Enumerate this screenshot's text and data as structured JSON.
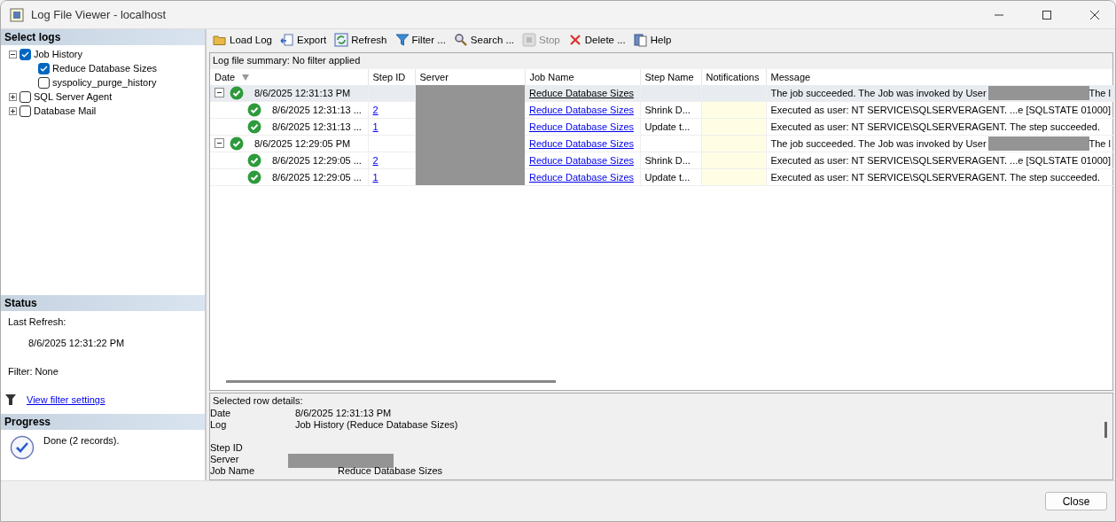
{
  "window": {
    "title": "Log File Viewer - localhost"
  },
  "select_logs": {
    "title": "Select logs",
    "tree": [
      {
        "label": "Job History",
        "checked": true,
        "expanded": true,
        "children": [
          {
            "label": "Reduce Database Sizes",
            "checked": true
          },
          {
            "label": "syspolicy_purge_history",
            "checked": false
          }
        ]
      },
      {
        "label": "SQL Server Agent",
        "checked": false,
        "expanded": false
      },
      {
        "label": "Database Mail",
        "checked": false,
        "expanded": false
      }
    ]
  },
  "status": {
    "title": "Status",
    "last_refresh_label": "Last Refresh:",
    "last_refresh": "8/6/2025 12:31:22 PM",
    "filter": "Filter: None",
    "link": "View filter settings"
  },
  "progress": {
    "title": "Progress",
    "text": "Done (2 records)."
  },
  "toolbar": [
    {
      "kind": "folder",
      "label": "Load Log",
      "disabled": false
    },
    {
      "kind": "export",
      "label": "Export",
      "disabled": false
    },
    {
      "kind": "refresh",
      "label": "Refresh",
      "disabled": false
    },
    {
      "kind": "filter",
      "label": "Filter ...",
      "disabled": false
    },
    {
      "kind": "search",
      "label": "Search ...",
      "disabled": false
    },
    {
      "kind": "stop",
      "label": "Stop",
      "disabled": true
    },
    {
      "kind": "delete",
      "label": "Delete ...",
      "disabled": false
    },
    {
      "kind": "help",
      "label": "Help",
      "disabled": false
    }
  ],
  "summary": "Log file summary: No filter applied",
  "table": {
    "columns": [
      "Date",
      "Step ID",
      "Server",
      "Job Name",
      "Step Name",
      "Notifications",
      "Message"
    ],
    "rows": [
      {
        "kind": "job",
        "expanded": true,
        "selected": true,
        "date": "8/6/2025 12:31:13 PM",
        "step_id": "",
        "job_name": "Reduce Database Sizes",
        "step_name": "",
        "message": "The job succeeded.  The Job was invoked by User",
        "message_tail": "The l"
      },
      {
        "kind": "step",
        "selected": false,
        "date": "8/6/2025 12:31:13 ...",
        "step_id": "2",
        "job_name": "Reduce Database Sizes",
        "step_name": "Shrink D...",
        "message": "Executed as user: NT SERVICE\\SQLSERVERAGENT. ...e [SQLSTATE 01000]"
      },
      {
        "kind": "step",
        "selected": false,
        "date": "8/6/2025 12:31:13 ...",
        "step_id": "1",
        "job_name": "Reduce Database Sizes",
        "step_name": "Update t...",
        "message": "Executed as user: NT SERVICE\\SQLSERVERAGENT. The step succeeded."
      },
      {
        "kind": "job",
        "expanded": true,
        "selected": false,
        "date": "8/6/2025 12:29:05 PM",
        "step_id": "",
        "job_name": "Reduce Database Sizes",
        "step_name": "",
        "message": "The job succeeded.  The Job was invoked by User",
        "message_tail": "The l"
      },
      {
        "kind": "step",
        "selected": false,
        "date": "8/6/2025 12:29:05 ...",
        "step_id": "2",
        "job_name": "Reduce Database Sizes",
        "step_name": "Shrink D...",
        "message": "Executed as user: NT SERVICE\\SQLSERVERAGENT. ...e [SQLSTATE 01000]"
      },
      {
        "kind": "step",
        "selected": false,
        "date": "8/6/2025 12:29:05 ...",
        "step_id": "1",
        "job_name": "Reduce Database Sizes",
        "step_name": "Update t...",
        "message": "Executed as user: NT SERVICE\\SQLSERVERAGENT. The step succeeded."
      }
    ]
  },
  "details": {
    "title": "Selected row details:",
    "fields": [
      {
        "kind": "text",
        "label": "Date",
        "value": "8/6/2025 12:31:13 PM"
      },
      {
        "kind": "text",
        "label": "Log",
        "value": "Job History (Reduce Database Sizes)"
      },
      {
        "kind": "gap"
      },
      {
        "kind": "text",
        "label": "Step ID"
      },
      {
        "kind": "redacted",
        "label": "Server"
      },
      {
        "kind": "wide",
        "label": "Job Name",
        "value": "Reduce Database Sizes"
      }
    ]
  },
  "buttons": [
    "Close"
  ]
}
